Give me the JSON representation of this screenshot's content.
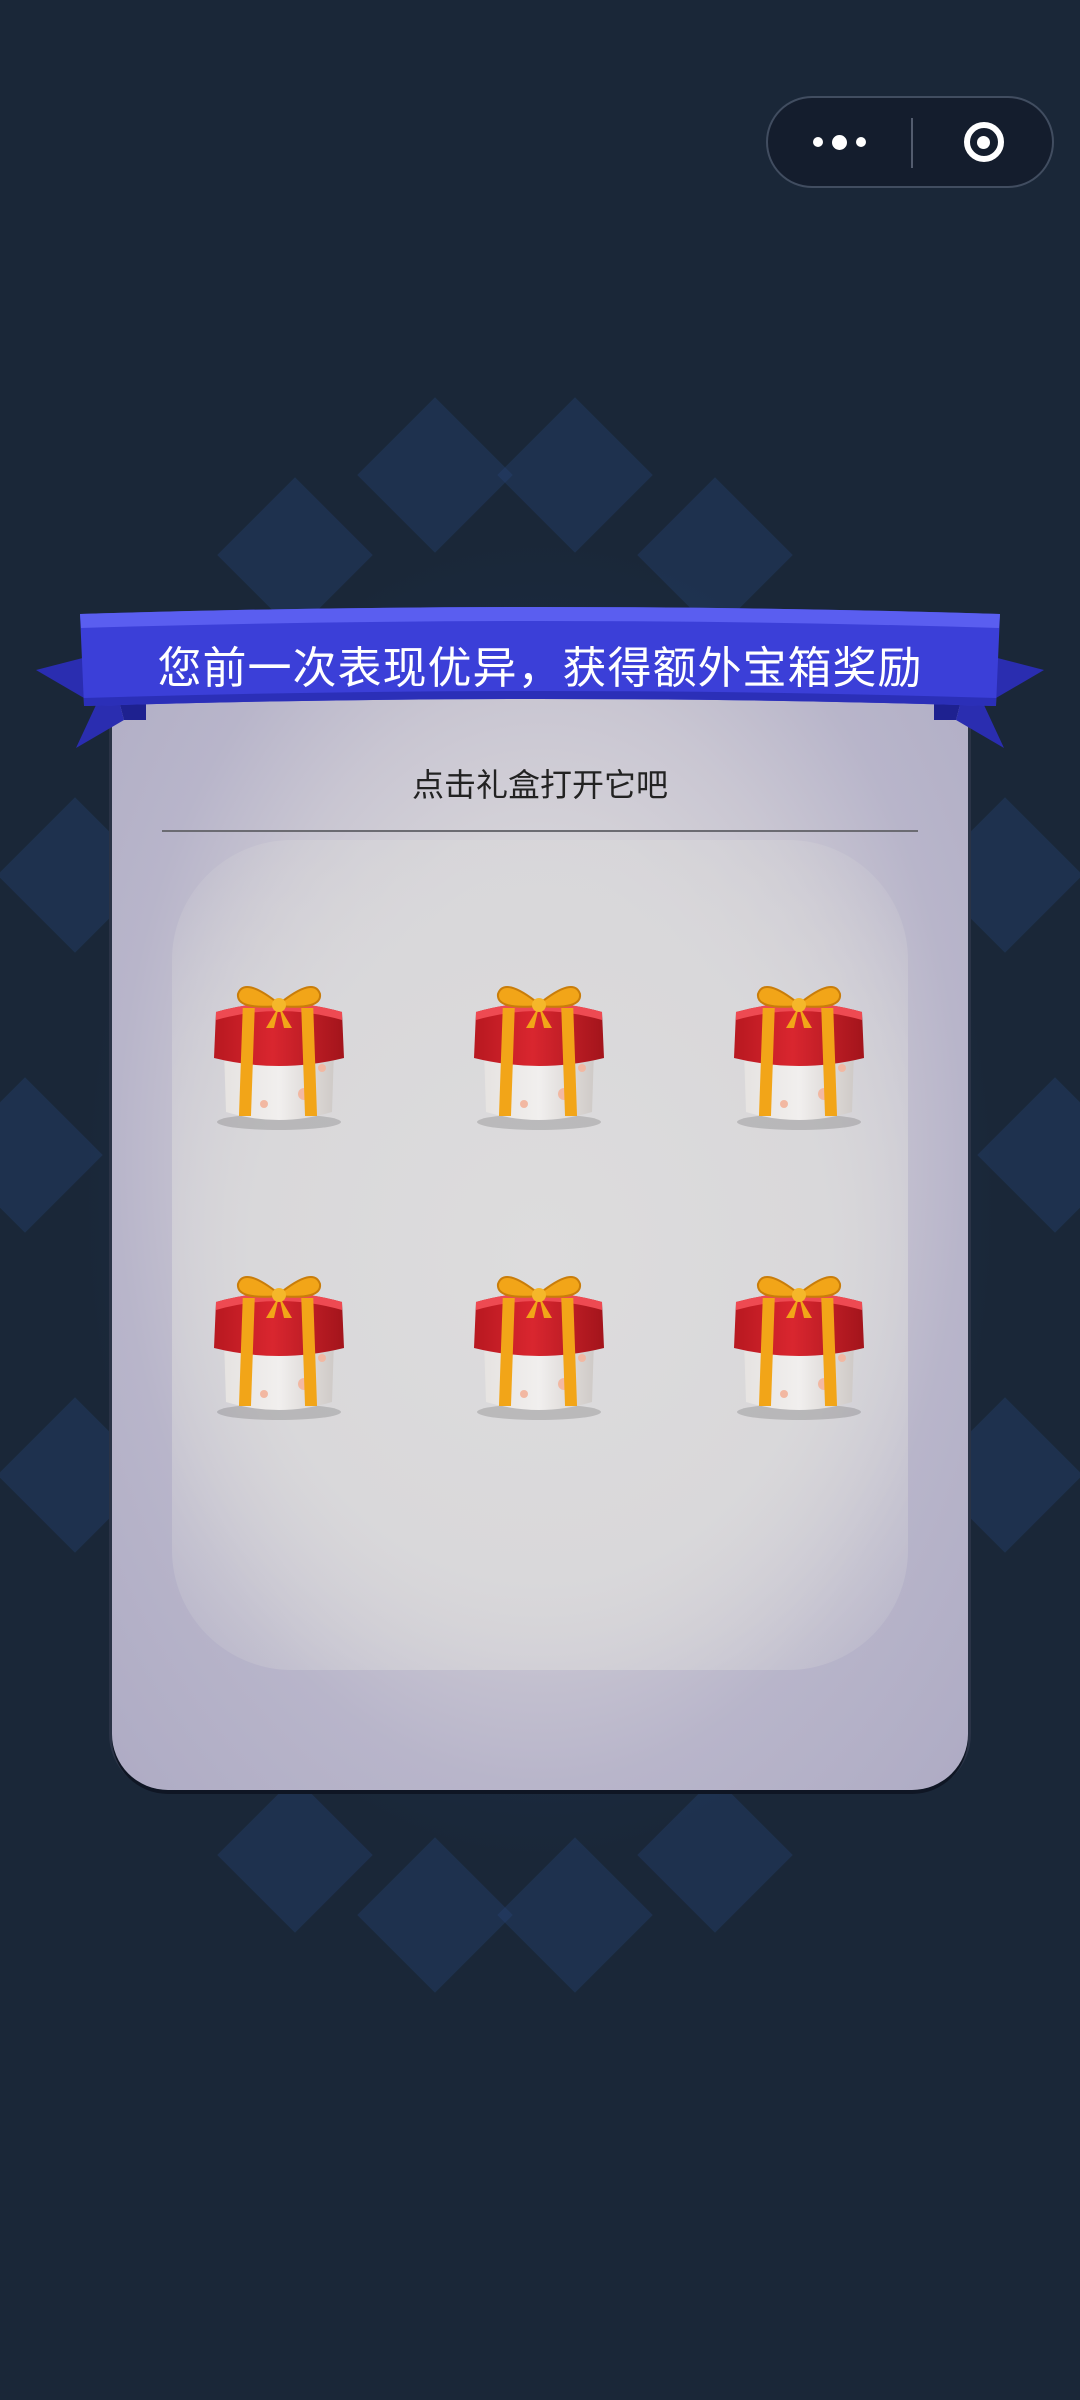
{
  "capsule": {
    "more_icon": "more-dots-icon",
    "close_icon": "target-close-icon"
  },
  "banner": {
    "title": "您前一次表现优异，获得额外宝箱奖励"
  },
  "panel": {
    "subtitle": "点击礼盒打开它吧",
    "gifts": [
      {
        "icon": "gift-box-icon"
      },
      {
        "icon": "gift-box-icon"
      },
      {
        "icon": "gift-box-icon"
      },
      {
        "icon": "gift-box-icon"
      },
      {
        "icon": "gift-box-icon"
      },
      {
        "icon": "gift-box-icon"
      }
    ]
  },
  "colors": {
    "background": "#1a2738",
    "banner": "#3b3fd8",
    "gift_lid": "#d9262f",
    "gift_ribbon": "#f2a518",
    "gift_box": "#f1efee"
  }
}
